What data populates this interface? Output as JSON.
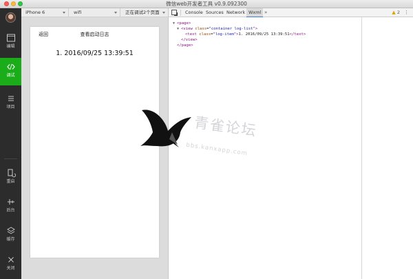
{
  "window": {
    "title": "微信web开发者工具 v0.9.092300"
  },
  "sidebar": {
    "items": [
      {
        "label": "编辑",
        "icon": "code-editor-icon"
      },
      {
        "label": "调试",
        "icon": "debug-brackets-icon",
        "active": true
      },
      {
        "label": "项目",
        "icon": "list-icon"
      },
      {
        "label": "重启",
        "icon": "restart-icon"
      },
      {
        "label": "后台",
        "icon": "background-icon"
      },
      {
        "label": "缓存",
        "icon": "cache-layers-icon"
      },
      {
        "label": "关闭",
        "icon": "close-icon"
      }
    ]
  },
  "device_bar": {
    "device": "iPhone 6",
    "network": "wifi",
    "status": "正在调试2个页面"
  },
  "simulator": {
    "nav_back": "返回",
    "nav_title": "查看启动日志",
    "log_items": [
      "1. 2016/09/25 13:39:51"
    ]
  },
  "devtools": {
    "tabs": [
      "Console",
      "Sources",
      "Network",
      "Wxml"
    ],
    "active_tab": "Wxml",
    "more": "»",
    "warnings": "2",
    "menu": "⋮",
    "dom": {
      "page_open": "<page>",
      "view_tag": "view",
      "view_attr_name": "class",
      "view_attr_value": "\"container log-list\"",
      "text_tag": "text",
      "text_attr_name": "class",
      "text_attr_value": "\"log-item\"",
      "text_content": "1. 2016/09/25 13:39:51",
      "text_close": "</text>",
      "view_close": "</view>",
      "page_close": "</page>"
    }
  },
  "watermark": {
    "text": "青雀论坛",
    "url": "bbs.kanxapp.com"
  },
  "colors": {
    "accent": "#1aad19",
    "sidebar_bg": "#2c2c2c",
    "tag": "#881280",
    "attr_name": "#994500",
    "attr_value": "#1a1aa6"
  }
}
